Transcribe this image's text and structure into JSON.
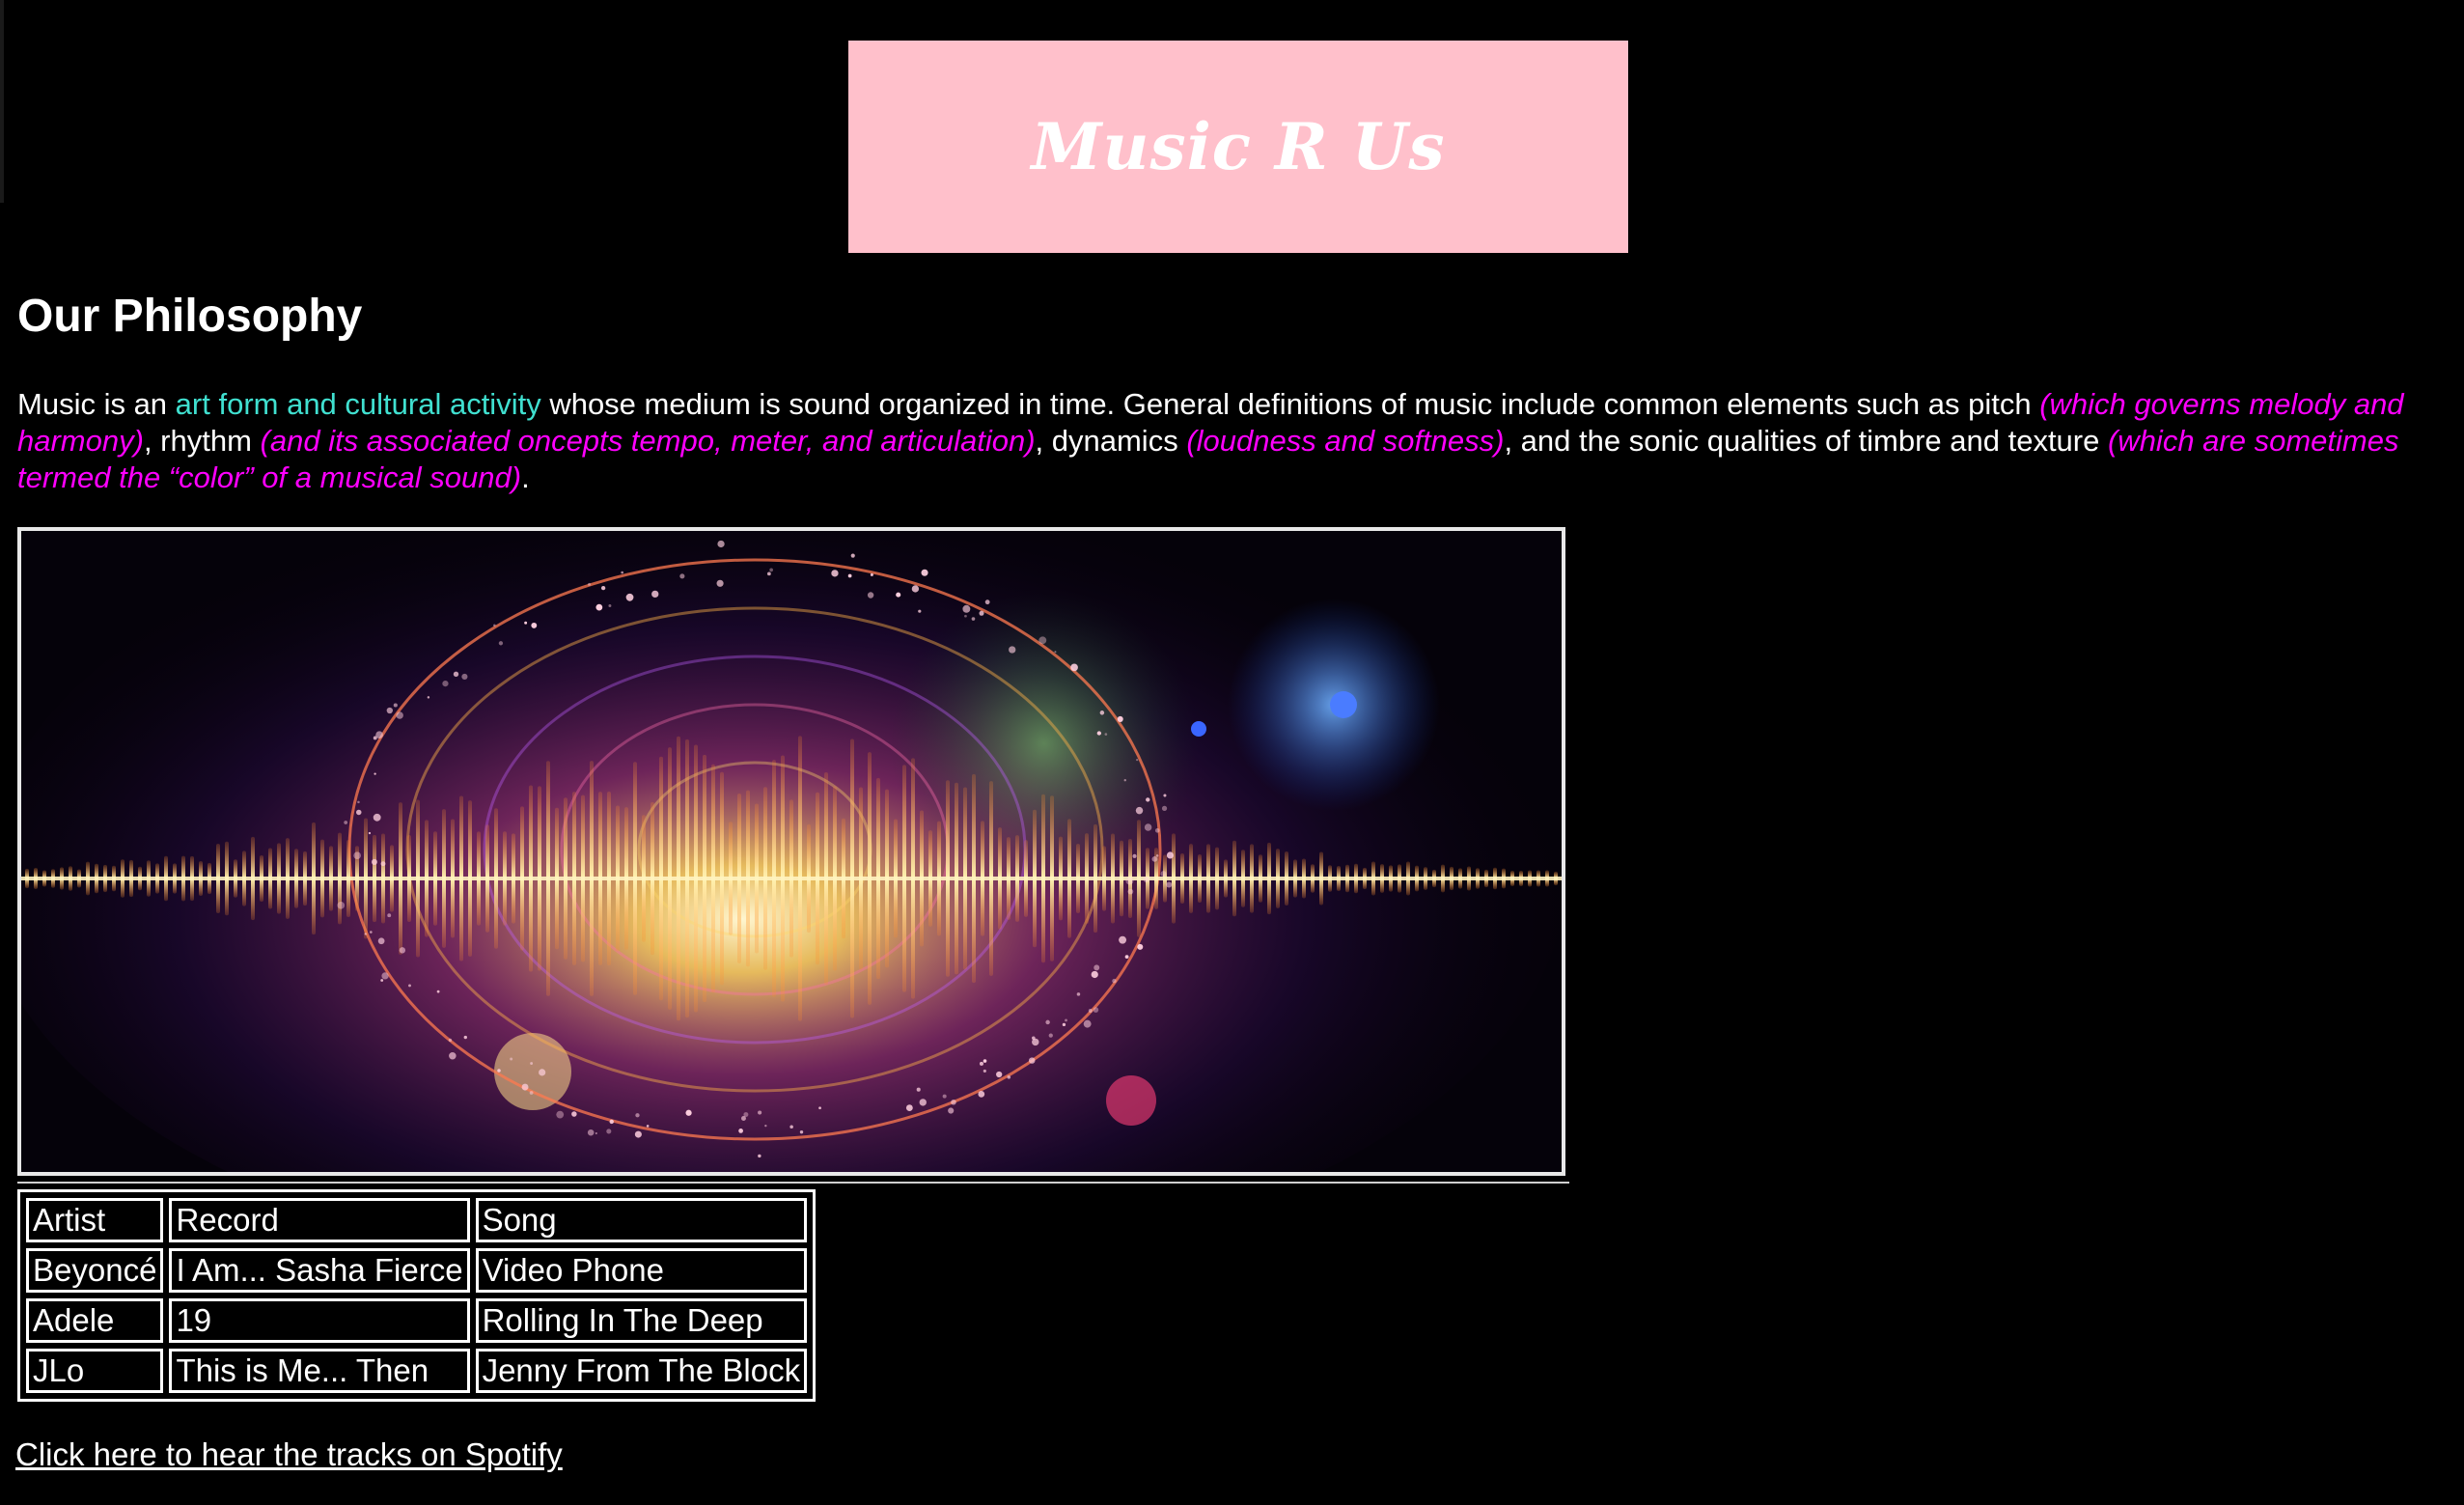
{
  "header": {
    "title": "Music R Us",
    "background_color": "#ffc0cb"
  },
  "philosophy": {
    "heading": "Our Philosophy",
    "segments": {
      "s1": "Music is an ",
      "s2": "art form and cultural activity",
      "s3": " whose medium is sound organized in time. General definitions of music include common elements such as pitch ",
      "s4": "(which governs melody and harmony)",
      "s5": ", rhythm ",
      "s6": "(and its associated oncepts tempo, meter, and articulation)",
      "s7": ", dynamics ",
      "s8": "(loudness and softness)",
      "s9": ", and the sonic qualities of timbre and texture ",
      "s10": "(which are sometimes termed the “color” of a musical sound)",
      "s11": "."
    },
    "highlight_color": "#40e0d0",
    "aside_color": "#ff00ff"
  },
  "banner_image": {
    "icon": "sound-wave-music-notes-image"
  },
  "table": {
    "headers": [
      "Artist",
      "Record",
      "Song"
    ],
    "rows": [
      [
        "Beyoncé",
        "I Am... Sasha Fierce",
        "Video Phone"
      ],
      [
        "Adele",
        "19",
        "Rolling In The Deep"
      ],
      [
        "JLo",
        "This is Me... Then",
        "Jenny From The Block"
      ]
    ]
  },
  "links": {
    "spotify": "Click here to hear the tracks on Spotify"
  }
}
